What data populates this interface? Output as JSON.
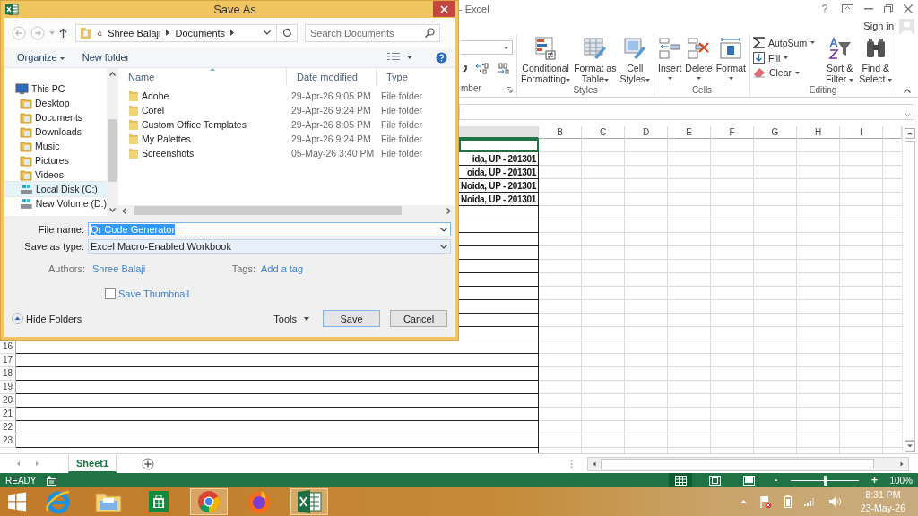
{
  "excel": {
    "title": "- Excel",
    "help": "?",
    "account": {
      "label": "Sign in"
    },
    "ribbon": {
      "number": {
        "label": "mber"
      },
      "groups": [
        {
          "label": "Styles",
          "buttons": [
            {
              "kind": "conditional",
              "lines": [
                "Conditional",
                "Formatting"
              ]
            },
            {
              "kind": "table",
              "lines": [
                "Format as",
                "Table"
              ]
            },
            {
              "kind": "cell_styles",
              "lines": [
                "Cell",
                "Styles"
              ]
            }
          ]
        },
        {
          "label": "Cells",
          "buttons": [
            {
              "kind": "insert",
              "lines": [
                "Insert"
              ]
            },
            {
              "kind": "delete",
              "lines": [
                "Delete"
              ]
            },
            {
              "kind": "format",
              "lines": [
                "Format"
              ]
            }
          ]
        }
      ],
      "editing": {
        "label": "Editing",
        "small": [
          {
            "kind": "autosum",
            "label": "AutoSum"
          },
          {
            "kind": "fill",
            "label": "Fill"
          },
          {
            "kind": "clear",
            "label": "Clear"
          }
        ],
        "large": [
          {
            "kind": "sort",
            "lines": [
              "Sort &",
              "Filter"
            ]
          },
          {
            "kind": "find",
            "lines": [
              "Find &",
              "Select"
            ]
          }
        ]
      }
    },
    "columns": [
      "B",
      "C",
      "D",
      "E",
      "F",
      "G",
      "H",
      "I"
    ],
    "column_a_texts": [
      "ida, UP - 201301",
      "oida, UP - 201301",
      "Noida, UP - 201301",
      "Noida, UP - 201301"
    ],
    "row_numbers": [
      "16",
      "17",
      "18",
      "19",
      "20",
      "21",
      "22",
      "23"
    ],
    "sheet_tabs": [
      {
        "label": "Sheet1",
        "selected": true
      }
    ],
    "status": {
      "mode": "READY",
      "views": [
        {
          "kind": "normal",
          "selected": true
        },
        {
          "kind": "page_layout",
          "selected": false
        },
        {
          "kind": "page_break",
          "selected": false
        }
      ],
      "zoom": {
        "minus": "-",
        "plus": "+",
        "level": 0.5,
        "reading": "100%"
      }
    }
  },
  "dialog": {
    "title": "Save As",
    "address": {
      "overflow": "«",
      "crumbs": [
        "Shree Balaji",
        "Documents"
      ]
    },
    "search": {
      "placeholder": "Search Documents"
    },
    "toolbar": {
      "organize": "Organize",
      "new_folder": "New folder"
    },
    "nav_items": [
      {
        "kind": "pc",
        "label": "This PC",
        "selected": false,
        "children": [
          {
            "kind": "folder",
            "label": "Desktop",
            "selected": false
          },
          {
            "kind": "folder",
            "label": "Documents",
            "selected": false
          },
          {
            "kind": "folder",
            "label": "Downloads",
            "selected": false
          },
          {
            "kind": "folder",
            "label": "Music",
            "selected": false
          },
          {
            "kind": "folder",
            "label": "Pictures",
            "selected": false
          },
          {
            "kind": "folder",
            "label": "Videos",
            "selected": false
          },
          {
            "kind": "drive",
            "label": "Local Disk (C:)",
            "selected": true
          },
          {
            "kind": "drive",
            "label": "New Volume (D:)",
            "selected": false
          }
        ]
      }
    ],
    "columns": [
      "Name",
      "Date modified",
      "Type"
    ],
    "files": [
      {
        "name": "Adobe",
        "date": "29-Apr-26 9:05 PM",
        "type": "File folder"
      },
      {
        "name": "Corel",
        "date": "29-Apr-26 9:24 PM",
        "type": "File folder"
      },
      {
        "name": "Custom Office Templates",
        "date": "29-Apr-26 8:05 PM",
        "type": "File folder"
      },
      {
        "name": "My Palettes",
        "date": "29-Apr-26 9:24 PM",
        "type": "File folder"
      },
      {
        "name": "Screenshots",
        "date": "05-May-26 3:40 PM",
        "type": "File folder"
      }
    ],
    "file_name": {
      "label": "File name:",
      "value": "Qr Code Generator",
      "value_selected": true
    },
    "save_type": {
      "label": "Save as type:",
      "value": "Excel Macro-Enabled Workbook"
    },
    "authors": {
      "label": "Authors:",
      "value": "Shree Balaji"
    },
    "tags": {
      "label": "Tags:",
      "value": "Add a tag"
    },
    "thumbnail": {
      "label": "Save Thumbnail",
      "checked": false
    },
    "hide_folders": "Hide Folders",
    "tools": "Tools",
    "buttons": [
      "Save",
      "Cancel"
    ]
  },
  "taskbar": {
    "apps": [
      {
        "kind": "ie",
        "active": false
      },
      {
        "kind": "explorer",
        "active": false
      },
      {
        "kind": "store",
        "active": false
      },
      {
        "kind": "chrome",
        "active": true
      },
      {
        "kind": "firefox",
        "active": false
      },
      {
        "kind": "excel",
        "active": true
      }
    ],
    "time": "8:31 PM",
    "date": "23-May-26"
  }
}
